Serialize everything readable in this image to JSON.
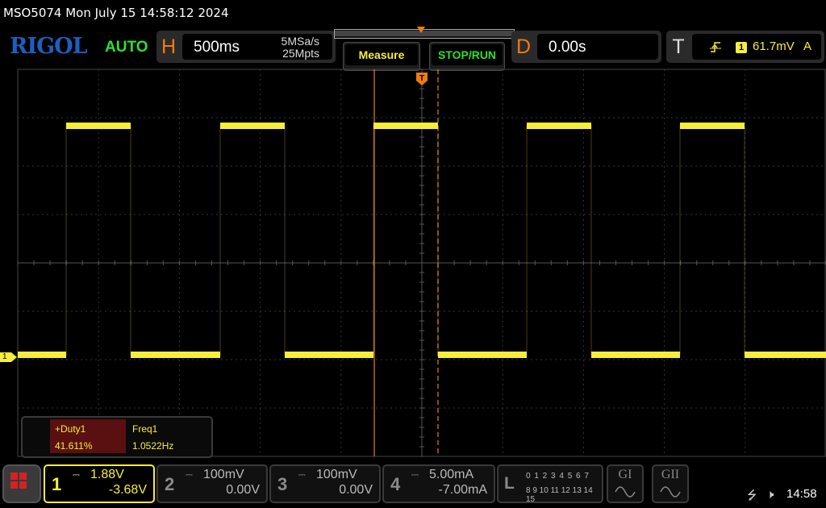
{
  "header": {
    "status_line": "MSO5074  Mon July 15 14:58:12 2024"
  },
  "toolbar": {
    "logo": "RIGOL",
    "mode": "AUTO",
    "horizontal": {
      "letter": "H",
      "timebase": "500ms",
      "sample_rate": "5MSa/s",
      "memory_depth": "25Mpts"
    },
    "measure_label": "Measure",
    "stop_run_label": "STOP/RUN",
    "delay": {
      "letter": "D",
      "value": "0.00s"
    },
    "trigger": {
      "letter": "T",
      "edge_icon": "rising-edge-icon",
      "source": "1",
      "level": "61.7mV",
      "sweep": "A"
    }
  },
  "screen": {
    "ch1_marker": "1",
    "trace_color": "#f5ee3a",
    "cursor_color": "#f07a12",
    "trigger_marker": "T",
    "waveform": {
      "high_segments_x": [
        [
          82,
          162
        ],
        [
          273,
          353
        ],
        [
          463,
          543
        ],
        [
          653,
          733
        ],
        [
          843,
          923
        ]
      ],
      "duty_percent": 41.611
    }
  },
  "measurements": {
    "duty": {
      "label": "+Duty1",
      "value": "41.611%"
    },
    "freq": {
      "label": "Freq1",
      "value": "1.0522Hz"
    }
  },
  "channels": [
    {
      "num": "1",
      "coupling": "DC",
      "scale": "1.88V",
      "offset": "-3.68V",
      "active": true
    },
    {
      "num": "2",
      "coupling": "DC",
      "scale": "100mV",
      "offset": "0.00V",
      "active": false
    },
    {
      "num": "3",
      "coupling": "DC",
      "scale": "100mV",
      "offset": "0.00V",
      "active": false
    },
    {
      "num": "4",
      "coupling": "DC",
      "scale": "5.00mA",
      "offset": "-7.00mA",
      "active": false
    }
  ],
  "logic": {
    "label": "L",
    "row1": "0 1 2 3  4 5 6 7",
    "row2": "8 9 10 11 12 13 14 15"
  },
  "decoders": [
    {
      "label": "GI"
    },
    {
      "label": "GII"
    }
  ],
  "status": {
    "usb_icon": "usb-icon",
    "speaker_icon": "speaker-muted-icon",
    "time": "14:58"
  }
}
